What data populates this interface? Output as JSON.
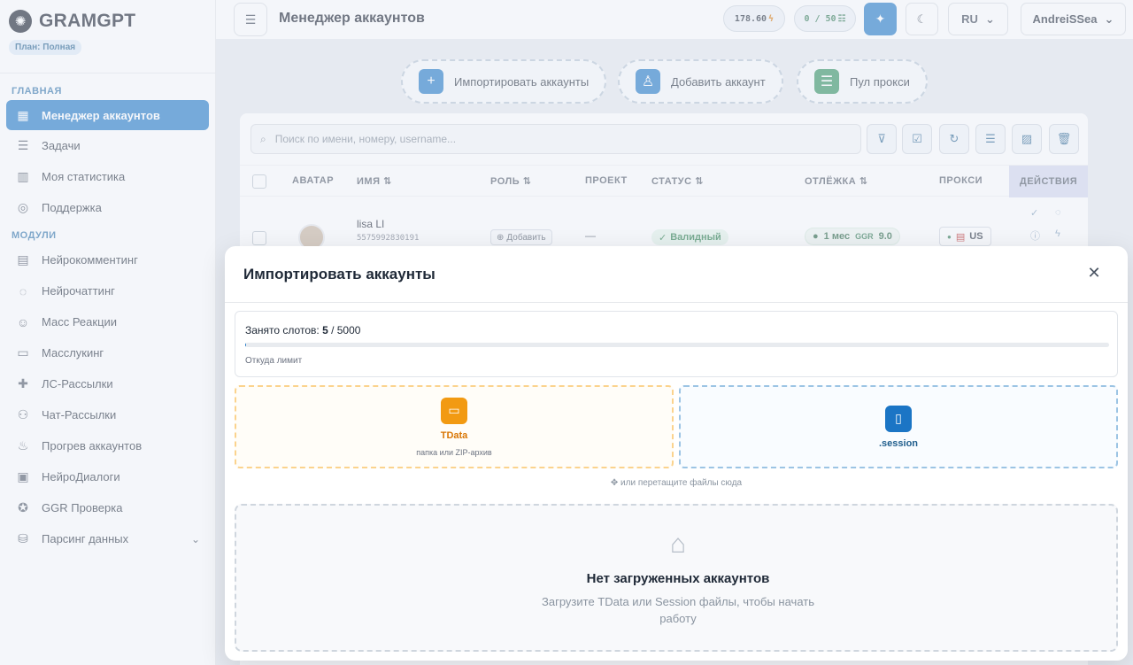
{
  "app": {
    "name": "GRAMGPT",
    "plan": "План: Полная"
  },
  "sidebar": {
    "section_main": "ГЛАВНАЯ",
    "main_items": [
      {
        "label": "Менеджер аккаунтов",
        "icon": "grid-icon",
        "active": true
      },
      {
        "label": "Задачи",
        "icon": "list-icon"
      },
      {
        "label": "Моя статистика",
        "icon": "chart-icon"
      },
      {
        "label": "Поддержка",
        "icon": "lifebuoy-icon"
      }
    ],
    "section_modules": "МОДУЛИ",
    "module_items": [
      {
        "label": "Нейрокомментинг",
        "icon": "comments-icon"
      },
      {
        "label": "Нейрочаттинг",
        "icon": "chat-icon"
      },
      {
        "label": "Масс Реакции",
        "icon": "smile-icon"
      },
      {
        "label": "Масслукинг",
        "icon": "monitor-icon"
      },
      {
        "label": "ЛС-Рассылки",
        "icon": "message-plus-icon"
      },
      {
        "label": "Чат-Рассылки",
        "icon": "users-icon"
      },
      {
        "label": "Прогрев аккаунтов",
        "icon": "flame-icon"
      },
      {
        "label": "НейроДиалоги",
        "icon": "dialogs-icon"
      },
      {
        "label": "GGR Проверка",
        "icon": "star-icon"
      },
      {
        "label": "Парсинг данных",
        "icon": "database-icon",
        "expandable": true
      }
    ]
  },
  "header": {
    "title": "Менеджер аккаунтов",
    "credits": "178.60",
    "slots": "0 / 50",
    "language": "RU",
    "user": "AndreiSSea"
  },
  "actions": {
    "import": "Импортировать аккаунты",
    "add": "Добавить аккаунт",
    "proxy_pool": "Пул прокси"
  },
  "table": {
    "search_placeholder": "Поиск по имени, номеру, username...",
    "columns": {
      "avatar": "АВАТАР",
      "name": "ИМЯ",
      "role": "РОЛЬ",
      "project": "ПРОЕКТ",
      "status": "СТАТУС",
      "rest": "ОТЛЁЖКА",
      "proxy": "ПРОКСИ",
      "actions": "ДЕЙСТВИЯ"
    },
    "rows": [
      {
        "name": "lisa LI",
        "phone": "5575992830191",
        "role_button": "Добавить",
        "project": "—",
        "status": "Валидный",
        "rest": "1 мес",
        "ggr_label": "GGR",
        "ggr_value": "9.0",
        "proxy": "US"
      }
    ]
  },
  "modal": {
    "title": "Импортировать аккаунты",
    "slots_label": "Занято слотов:",
    "slots_used": "5",
    "slots_total": "/ 5000",
    "slots_fraction": 0.001,
    "slots_note": "Откуда лимит",
    "tdata_label": "TData",
    "tdata_sub": "папка или ZIP-архив",
    "session_label": ".session",
    "drag_hint": "или перетащите файлы сюда",
    "empty_title": "Нет загруженных аккаунтов",
    "empty_sub": "Загрузите TData или Session файлы, чтобы начать работу"
  },
  "colors": {
    "accent": "#1b75c5",
    "success": "#237a46",
    "tdata": "#f29a12"
  }
}
